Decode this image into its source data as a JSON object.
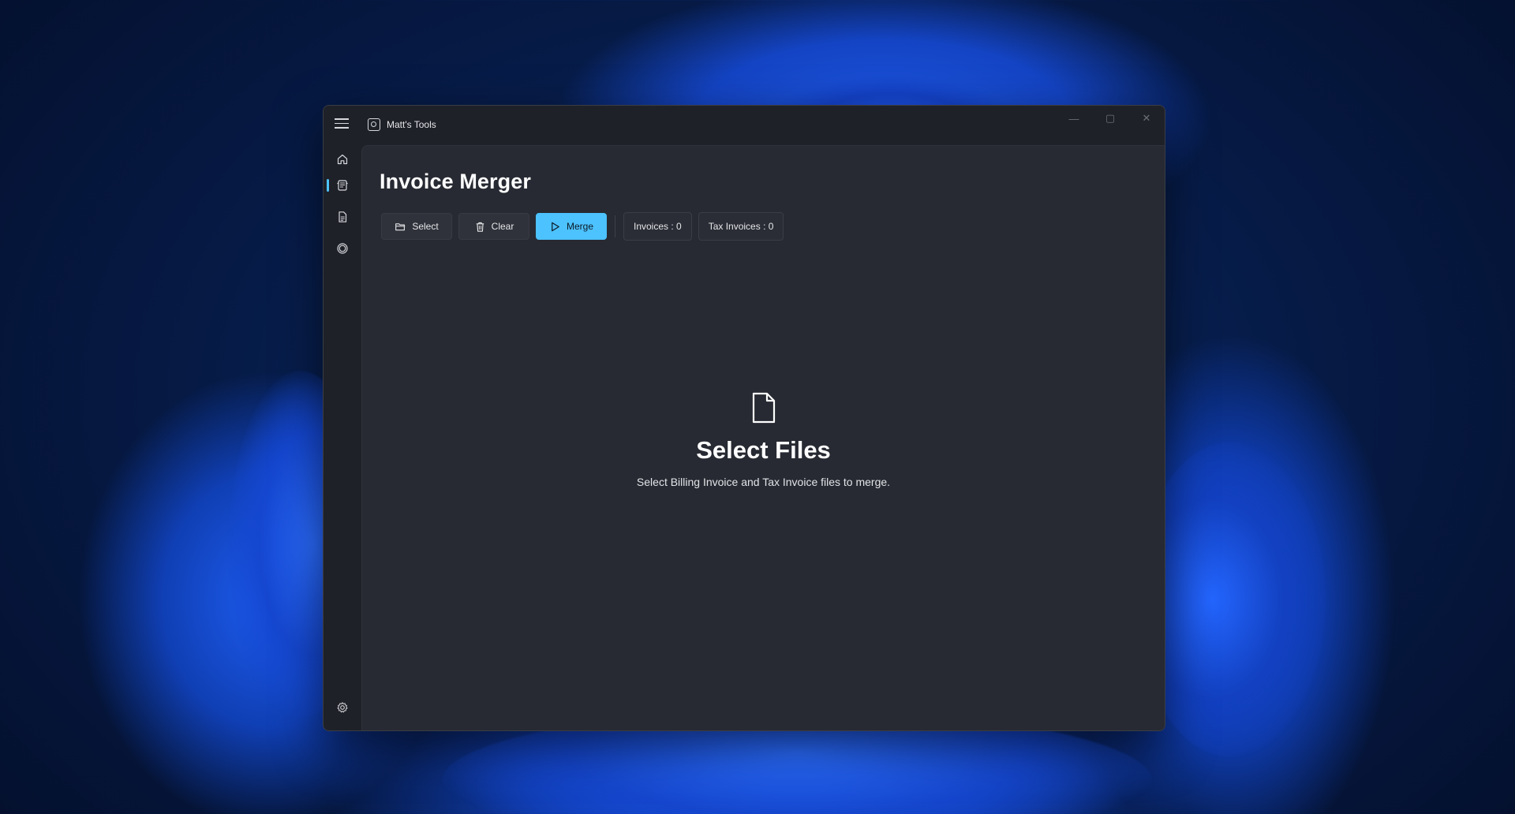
{
  "window": {
    "title": "Matt's Tools",
    "caption": {
      "minimize": "—",
      "maximize": "▢",
      "close": "✕"
    }
  },
  "navigation": {
    "items": [
      {
        "name": "home",
        "icon": "home-icon"
      },
      {
        "name": "invoice-merger",
        "icon": "invoice-merger-icon",
        "selected": true
      },
      {
        "name": "documents",
        "icon": "document-icon"
      },
      {
        "name": "circle-tool",
        "icon": "circle-icon"
      }
    ],
    "footer": {
      "name": "settings",
      "icon": "gear-icon"
    }
  },
  "page": {
    "title": "Invoice Merger"
  },
  "toolbar": {
    "select_label": "Select",
    "clear_label": "Clear",
    "merge_label": "Merge",
    "invoices_count": "Invoices : 0",
    "tax_invoices_count": "Tax Invoices : 0"
  },
  "empty_state": {
    "icon": "file-icon",
    "title": "Select Files",
    "description": "Select Billing Invoice and Tax Invoice files to merge."
  },
  "colors": {
    "accent": "#4cc2ff",
    "window_bg": "#1f2128",
    "content_bg": "#272a32"
  }
}
